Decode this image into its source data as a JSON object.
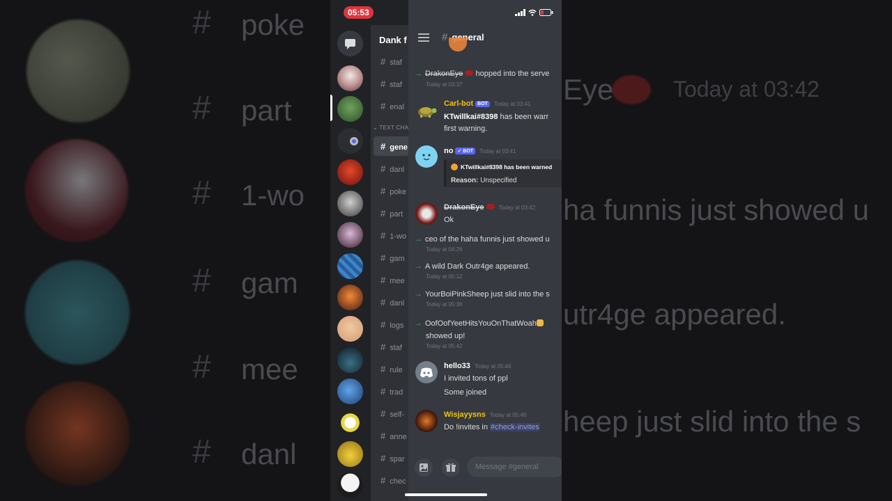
{
  "status": {
    "time": "05:53"
  },
  "background": {
    "hash": "#",
    "hash_texts": [
      "poke",
      "part",
      "1-wo",
      "gam",
      "mee",
      "danl"
    ],
    "right_texts": [
      "Eye",
      "Today at 03:42",
      "ha funnis just showed u",
      "utr4ge appeared.",
      "heep just slid into the s"
    ]
  },
  "sidebar": {
    "server_name": "Dank f",
    "category": "TEXT CHA",
    "channels_top": [
      "staf",
      "staf",
      "enal"
    ],
    "channels": [
      "gene",
      "danl",
      "poke",
      "part",
      "1-wo",
      "gam",
      "mee",
      "danl",
      "logs",
      "staf",
      "rule",
      "trad",
      "self-",
      "anne",
      "spar",
      "chec"
    ]
  },
  "chat": {
    "hash": "#",
    "channel": "general",
    "messages": {
      "m1": {
        "text": "DrakonEye",
        "rest": "hopped into the serve",
        "time": "Today at 03:37"
      },
      "m2": {
        "author": "Carl-bot",
        "badge": "BOT",
        "time": "Today at 03:41",
        "mention": "KTwillkai#8398",
        "line1": "has been warr",
        "line2": "first warning."
      },
      "m3": {
        "author": "no",
        "badge": "✓ BOT",
        "time": "Today at 03:41",
        "embed_title": "KTwillkai#8398 has been warned",
        "embed_reason_label": "Reason:",
        "embed_reason": "Unspecified"
      },
      "m4": {
        "author": "DrakonEye",
        "time": "Today at 03:42",
        "body": "Ok"
      },
      "m5": {
        "text": "ceo of the haha funnis just showed u",
        "time": "Today at 04:26"
      },
      "m6": {
        "text": "A wild Dark Outr4ge appeared.",
        "time": "Today at 05:12"
      },
      "m7": {
        "text": "YourBoiPinkSheep just slid into the s",
        "time": "Today at 05:36"
      },
      "m8": {
        "text": "OofOofYeetHitsYouOnThatWoah",
        "line2": "showed up!",
        "time": "Today at 05:42"
      },
      "m9": {
        "author": "hello33",
        "time": "Today at 05:46",
        "line1": "I invited tons of ppl",
        "line2": "Some joined"
      },
      "m10": {
        "author": "Wisjayysns",
        "time": "Today at 05:46",
        "prefix": "Do !invites in",
        "channel_link": "#check-invites"
      }
    },
    "composer_placeholder": "Message #general"
  },
  "colors": {
    "accent": "#5865f2",
    "join_arrow": "#3ba55d",
    "carl_bot": "#f1c40f",
    "wisjayysns": "#f1c40f",
    "time_pill": "#e0343c"
  }
}
